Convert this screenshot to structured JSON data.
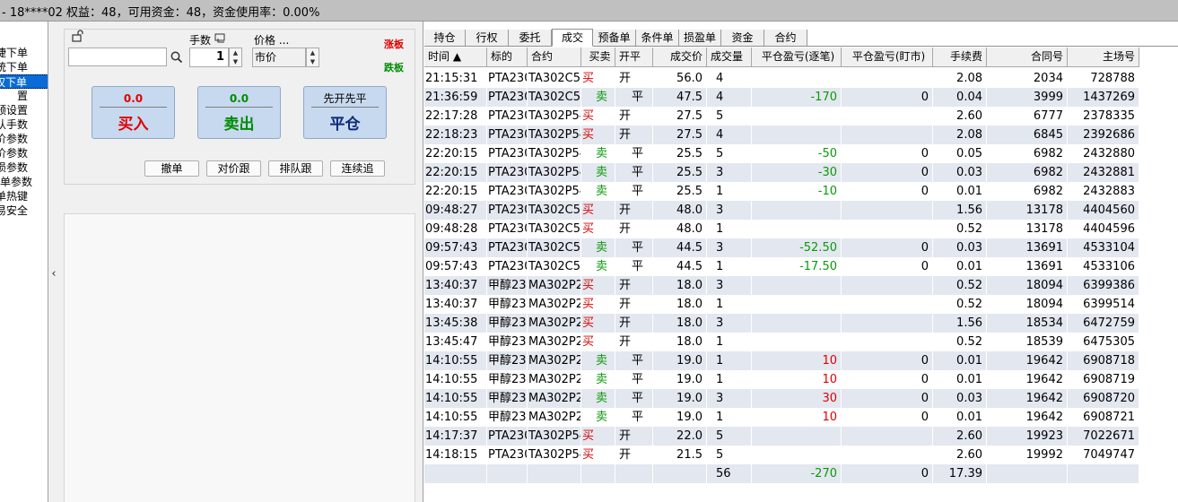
{
  "titlebar": {
    "text": "- 18****02  权益：48，可用资金：48，资金使用率：0.00%"
  },
  "leftnav": {
    "items": [
      {
        "label": "捷下单",
        "selected": false
      },
      {
        "label": "统下单",
        "selected": false
      },
      {
        "label": "权下单",
        "selected": true
      },
      {
        "label": "置",
        "selected": false
      },
      {
        "label": "预设置",
        "selected": false
      },
      {
        "label": "认手数",
        "selected": false
      },
      {
        "label": "价参数",
        "selected": false
      },
      {
        "label": "价参数",
        "selected": false
      },
      {
        "label": "损参数",
        "selected": false
      },
      {
        "label": "件单参数",
        "selected": false
      },
      {
        "label": "单热键",
        "selected": false
      },
      {
        "label": "易安全",
        "selected": false
      }
    ]
  },
  "order": {
    "symbol_value": "",
    "lots_label": "手数",
    "lots_value": "1",
    "price_label": "价格 ...",
    "price_value": "市价",
    "limit_up": "涨板",
    "limit_down": "跌板",
    "buy": {
      "price": "0.0",
      "label": "买入"
    },
    "sell": {
      "price": "0.0",
      "label": "卖出"
    },
    "close": {
      "top": "先开先平",
      "label": "平仓"
    },
    "btn_cancel": "撤单",
    "btn_chase_opp": "对价跟",
    "btn_chase_queue": "排队跟",
    "btn_continuous": "连续追"
  },
  "tabs": [
    "持仓",
    "行权",
    "委托",
    "成交",
    "预备单",
    "条件单",
    "损盈单",
    "资金",
    "合约"
  ],
  "active_tab": "成交",
  "table": {
    "headers": [
      "时间 ▲",
      "标的",
      "合约",
      "买卖",
      "开平",
      "成交价",
      "成交量",
      "平仓盈亏(逐笔)",
      "平仓盈亏(盯市)",
      "手续费",
      "合同号",
      "主场号"
    ],
    "rows": [
      [
        "21:15:31",
        "PTA2302",
        "TA302C5500",
        "买",
        "开",
        "56.0",
        "4",
        "",
        "",
        "2.08",
        "2034",
        "728788"
      ],
      [
        "21:36:59",
        "PTA2302",
        "TA302C5500",
        "卖",
        "平",
        "47.5",
        "4",
        "-170",
        "0",
        "0.04",
        "3999",
        "1437269"
      ],
      [
        "22:17:28",
        "PTA2302",
        "TA302P5400",
        "买",
        "开",
        "27.5",
        "5",
        "",
        "",
        "2.60",
        "6777",
        "2378335"
      ],
      [
        "22:18:23",
        "PTA2302",
        "TA302P5400",
        "买",
        "开",
        "27.5",
        "4",
        "",
        "",
        "2.08",
        "6845",
        "2392686"
      ],
      [
        "22:20:15",
        "PTA2302",
        "TA302P5400",
        "卖",
        "平",
        "25.5",
        "5",
        "-50",
        "0",
        "0.05",
        "6982",
        "2432880"
      ],
      [
        "22:20:15",
        "PTA2302",
        "TA302P5400",
        "卖",
        "平",
        "25.5",
        "3",
        "-30",
        "0",
        "0.03",
        "6982",
        "2432881"
      ],
      [
        "22:20:15",
        "PTA2302",
        "TA302P5400",
        "卖",
        "平",
        "25.5",
        "1",
        "-10",
        "0",
        "0.01",
        "6982",
        "2432883"
      ],
      [
        "09:48:27",
        "PTA2302",
        "TA302C5500",
        "买",
        "开",
        "48.0",
        "3",
        "",
        "",
        "1.56",
        "13178",
        "4404560"
      ],
      [
        "09:48:28",
        "PTA2302",
        "TA302C5500",
        "买",
        "开",
        "48.0",
        "1",
        "",
        "",
        "0.52",
        "13178",
        "4404596"
      ],
      [
        "09:57:43",
        "PTA2302",
        "TA302C5500",
        "卖",
        "平",
        "44.5",
        "3",
        "-52.50",
        "0",
        "0.03",
        "13691",
        "4533104"
      ],
      [
        "09:57:43",
        "PTA2302",
        "TA302C5500",
        "卖",
        "平",
        "44.5",
        "1",
        "-17.50",
        "0",
        "0.01",
        "13691",
        "4533106"
      ],
      [
        "13:40:37",
        "甲醇2302",
        "MA302P2500",
        "买",
        "开",
        "18.0",
        "3",
        "",
        "",
        "0.52",
        "18094",
        "6399386"
      ],
      [
        "13:40:37",
        "甲醇2302",
        "MA302P2500",
        "买",
        "开",
        "18.0",
        "1",
        "",
        "",
        "0.52",
        "18094",
        "6399514"
      ],
      [
        "13:45:38",
        "甲醇2302",
        "MA302P2500",
        "买",
        "开",
        "18.0",
        "3",
        "",
        "",
        "1.56",
        "18534",
        "6472759"
      ],
      [
        "13:45:47",
        "甲醇2302",
        "MA302P2500",
        "买",
        "开",
        "18.0",
        "1",
        "",
        "",
        "0.52",
        "18539",
        "6475305"
      ],
      [
        "14:10:55",
        "甲醇2302",
        "MA302P2500",
        "卖",
        "平",
        "19.0",
        "1",
        "10",
        "0",
        "0.01",
        "19642",
        "6908718"
      ],
      [
        "14:10:55",
        "甲醇2302",
        "MA302P2500",
        "卖",
        "平",
        "19.0",
        "1",
        "10",
        "0",
        "0.01",
        "19642",
        "6908719"
      ],
      [
        "14:10:55",
        "甲醇2302",
        "MA302P2500",
        "卖",
        "平",
        "19.0",
        "3",
        "30",
        "0",
        "0.03",
        "19642",
        "6908720"
      ],
      [
        "14:10:55",
        "甲醇2302",
        "MA302P2500",
        "卖",
        "平",
        "19.0",
        "1",
        "10",
        "0",
        "0.01",
        "19642",
        "6908721"
      ],
      [
        "14:17:37",
        "PTA2302",
        "TA302P5400",
        "买",
        "开",
        "22.0",
        "5",
        "",
        "",
        "2.60",
        "19923",
        "7022671"
      ],
      [
        "14:18:15",
        "PTA2302",
        "TA302P5400",
        "买",
        "开",
        "21.5",
        "5",
        "",
        "",
        "2.60",
        "19992",
        "7049747"
      ]
    ],
    "summary": [
      "",
      "",
      "",
      "",
      "",
      "",
      "56",
      "-270",
      "0",
      "17.39",
      "",
      ""
    ]
  },
  "colors": {
    "buy": "#e00000",
    "sell": "#0a9a0a",
    "selection": "#0a6bd6",
    "row_alt": "#e3e7ef"
  }
}
